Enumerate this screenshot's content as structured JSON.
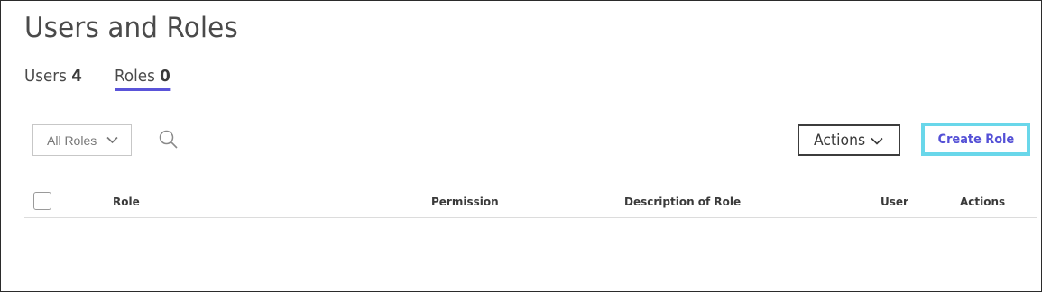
{
  "header": {
    "title": "Users and Roles"
  },
  "tabs": [
    {
      "label": "Users",
      "count": "4",
      "active": false
    },
    {
      "label": "Roles",
      "count": "0",
      "active": true
    }
  ],
  "toolbar": {
    "filter_value": "All Roles",
    "actions_label": "Actions",
    "create_label": "Create Role"
  },
  "table": {
    "columns": [
      "Role",
      "Permission",
      "Description of Role",
      "User",
      "Actions"
    ],
    "rows": []
  },
  "colors": {
    "accent": "#5a54d9",
    "focus_outline": "#69d7ea"
  },
  "icons": {
    "search": "search-icon",
    "chevron": "chevron-down-icon"
  }
}
